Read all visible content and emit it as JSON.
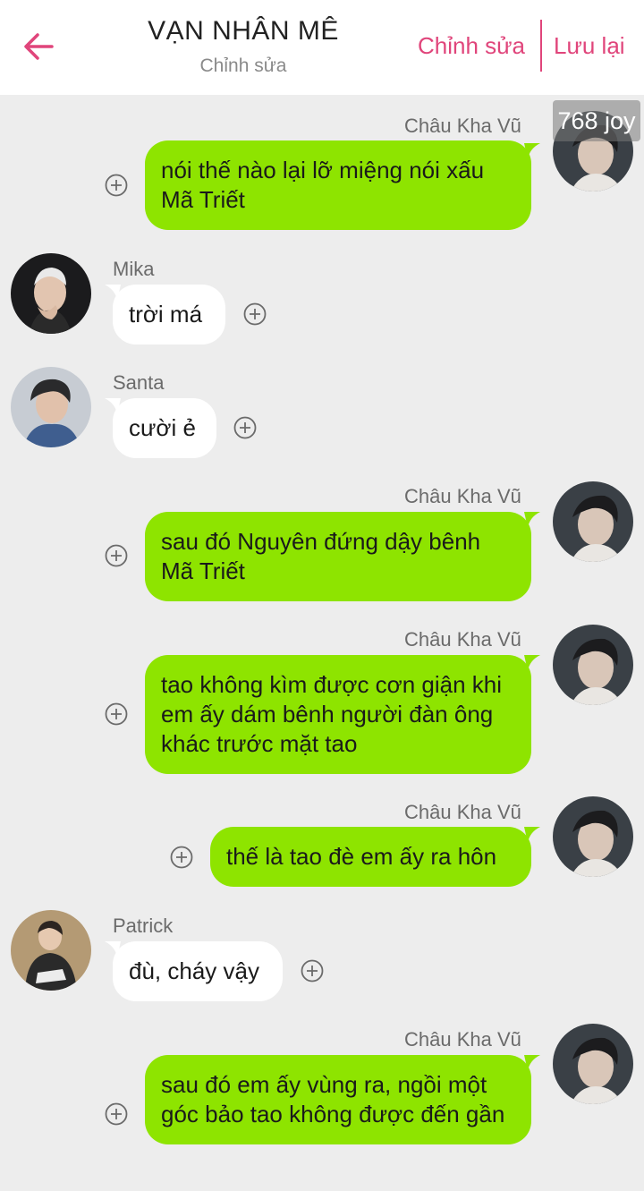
{
  "header": {
    "title": "VẠN NHÂN MÊ",
    "subtitle": "Chỉnh sửa",
    "edit_label": "Chỉnh sửa",
    "save_label": "Lưu lại"
  },
  "joy_badge": "768 joy",
  "colors": {
    "accent": "#e0457b",
    "outgoing_bubble": "#8ee400",
    "incoming_bubble": "#ffffff",
    "background": "#ededed"
  },
  "messages": [
    {
      "sender": "Châu Kha Vũ",
      "text": "nói thế nào lại lỡ miệng nói xấu Mã Triết",
      "side": "right"
    },
    {
      "sender": "Mika",
      "text": "trời má",
      "side": "left"
    },
    {
      "sender": "Santa",
      "text": "cười ẻ",
      "side": "left"
    },
    {
      "sender": "Châu Kha Vũ",
      "text": "sau đó Nguyên đứng dậy bênh Mã Triết",
      "side": "right"
    },
    {
      "sender": "Châu Kha Vũ",
      "text": "tao không kìm được cơn giận khi em ấy dám bênh người đàn ông khác trước mặt tao",
      "side": "right"
    },
    {
      "sender": "Châu Kha Vũ",
      "text": "thế là tao đè em ấy ra hôn",
      "side": "right"
    },
    {
      "sender": "Patrick",
      "text": "đù, cháy vậy",
      "side": "left"
    },
    {
      "sender": "Châu Kha Vũ",
      "text": "sau đó em ấy vùng ra, ngồi một góc bảo tao không được đến gần",
      "side": "right"
    }
  ]
}
